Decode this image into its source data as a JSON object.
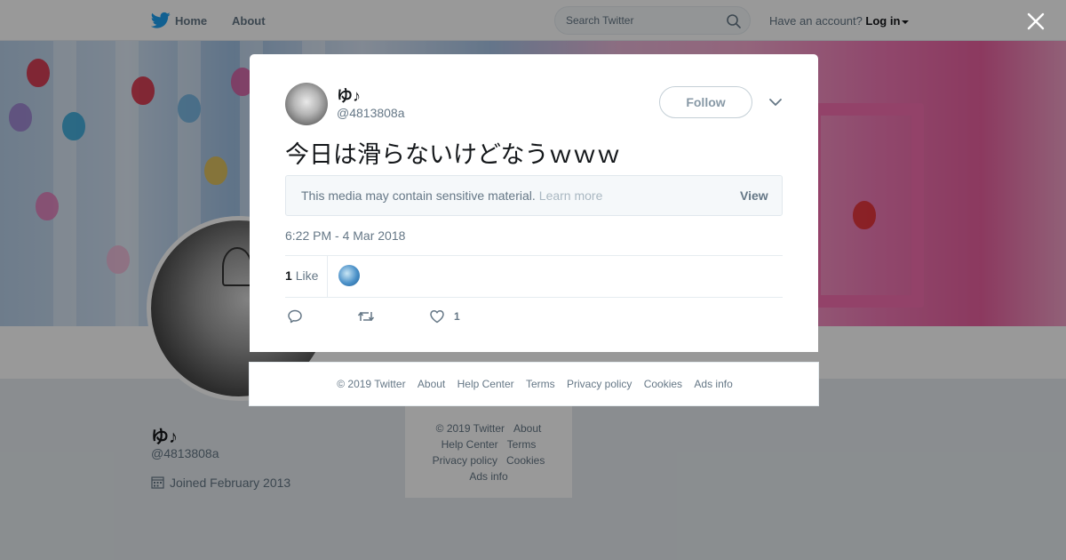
{
  "nav": {
    "home": "Home",
    "about": "About",
    "search_placeholder": "Search Twitter",
    "account_prompt": "Have an account?",
    "login": "Log in"
  },
  "profile": {
    "name": "ゆ♪",
    "handle": "@4813808a",
    "joined": "Joined February 2013"
  },
  "side_footer": {
    "line1": [
      "© 2019 Twitter",
      "About"
    ],
    "line2": [
      "Help Center",
      "Terms"
    ],
    "line3": [
      "Privacy policy",
      "Cookies"
    ],
    "line4": [
      "Ads info"
    ]
  },
  "tweet": {
    "author_name": "ゆ♪",
    "author_handle": "@4813808a",
    "follow_label": "Follow",
    "text": "今日は滑らないけどなうｗｗｗ",
    "sensitive_text": "This media may contain sensitive material.",
    "sensitive_learn": "Learn more",
    "sensitive_view": "View",
    "timestamp": "6:22 PM - 4 Mar 2018",
    "likes_number": "1",
    "likes_label": "Like",
    "like_action_count": "1"
  },
  "modal_footer": {
    "links": [
      "© 2019 Twitter",
      "About",
      "Help Center",
      "Terms",
      "Privacy policy",
      "Cookies",
      "Ads info"
    ]
  },
  "colors": {
    "twitter_blue": "#1da1f2",
    "text_secondary": "#657786"
  },
  "icons": {
    "logo": "twitter-bird-icon",
    "search": "search-icon",
    "close": "close-icon",
    "chevron": "chevron-down-icon",
    "calendar": "calendar-icon",
    "reply": "reply-icon",
    "retweet": "retweet-icon",
    "like": "heart-icon"
  }
}
